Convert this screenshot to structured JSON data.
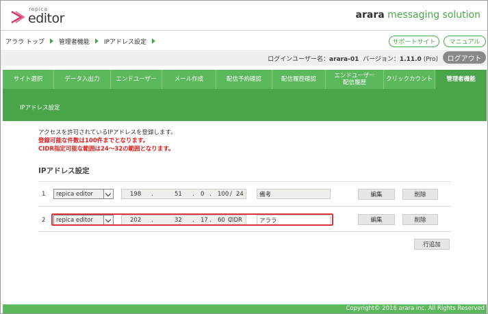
{
  "header": {
    "logo_small": "repica",
    "logo_big": "editor",
    "brand_bold": "arara",
    "brand_rest": " messaging solution"
  },
  "breadcrumb": [
    "アララ トップ",
    "管理者機能",
    "IPアドレス設定"
  ],
  "top_buttons": {
    "support": "サポートサイト",
    "manual": "マニュアル"
  },
  "user_info": {
    "login_label": "ログインユーザー名：",
    "login_user": "arara-01",
    "version_label": "バージョン：",
    "version": "1.11.0",
    "edition": "(Pro)",
    "logout": "ログアウト"
  },
  "nav": [
    {
      "label": "サイト選択",
      "active": false
    },
    {
      "label": "データ入出力",
      "active": false
    },
    {
      "label": "エンドユーザー",
      "active": false
    },
    {
      "label": "メール作成",
      "active": false
    },
    {
      "label": "配信予約確認",
      "active": false
    },
    {
      "label": "配信履歴確認",
      "active": false
    },
    {
      "label": "エンドユーザー\n配信履歴",
      "active": false
    },
    {
      "label": "クリックカウント",
      "active": false
    },
    {
      "label": "管理者機能",
      "active": true
    }
  ],
  "page": {
    "subheader": "IPアドレス設定",
    "desc_line1": "アクセスを許可されているIPアドレスを登録します。",
    "desc_line2": "登録可能な件数は100件までとなります。",
    "desc_line3": "CIDR指定可能な範囲は24～32の範囲となります。",
    "section_title": "IPアドレス設定",
    "add_button": "行追加"
  },
  "rows": [
    {
      "num": "1",
      "select": "repica editor",
      "ip": [
        "198",
        "51",
        "0",
        "100"
      ],
      "cidr": "24",
      "note": "備考",
      "edit": "編集",
      "delete": "削除"
    },
    {
      "num": "2",
      "select": "repica editor",
      "ip": [
        "202",
        "32",
        "17",
        "60"
      ],
      "cidr": "CIDR",
      "note": "アララ",
      "edit": "編集",
      "delete": "削除"
    }
  ],
  "ip_separators": {
    "dot": ".",
    "slash": "/"
  },
  "footer": "Copyright© 2016 arara inc. All Rights Reserved",
  "colors": {
    "green": "#5cb85c",
    "dark_green": "#4aa44a",
    "highlight_red": "#e0323a"
  }
}
